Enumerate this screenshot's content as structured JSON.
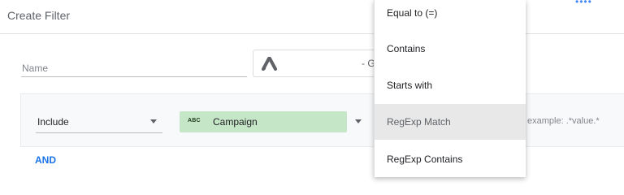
{
  "header": {
    "title": "Create Filter",
    "more_icon": "more-dots-icon"
  },
  "name_field": {
    "placeholder": "Name",
    "value": ""
  },
  "data_source": {
    "icon": "google-ads-logo-icon",
    "text": "- G"
  },
  "condition": {
    "include_select": "Include",
    "dimension": {
      "type_icon": "ABC",
      "label": "Campaign"
    },
    "value_placeholder": "example: .*value.*"
  },
  "and_button": "AND",
  "match_type_dropdown": {
    "items": [
      "Equal to (=)",
      "Contains",
      "Starts with",
      "RegExp Match",
      "RegExp Contains"
    ],
    "selected": "RegExp Match"
  },
  "colors": {
    "accent": "#1a73e8",
    "chip": "#c6e6c8",
    "selected_row": "#e8e8e8"
  }
}
